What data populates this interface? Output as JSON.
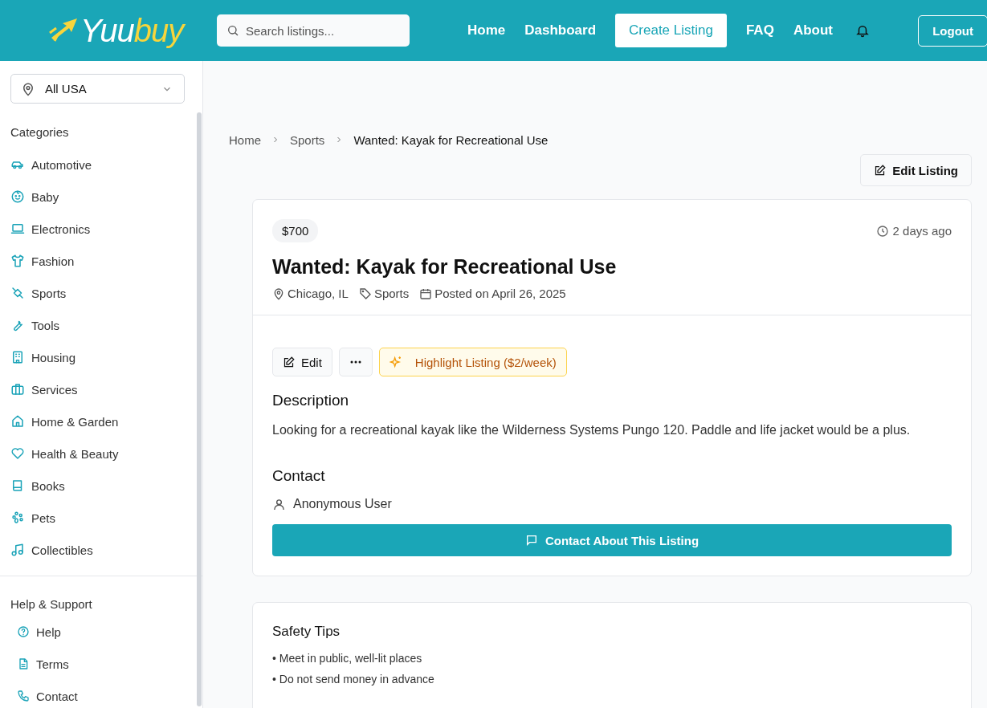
{
  "header": {
    "logo": {
      "part1": "Yuu",
      "part2": "buy"
    },
    "search": {
      "placeholder": "Search listings..."
    },
    "nav": [
      {
        "label": "Home",
        "kind": "link"
      },
      {
        "label": "Dashboard",
        "kind": "link"
      },
      {
        "label": "Create Listing",
        "kind": "primary"
      },
      {
        "label": "FAQ",
        "kind": "link"
      },
      {
        "label": "About",
        "kind": "link"
      }
    ],
    "logout": "Logout"
  },
  "sidebar": {
    "location": {
      "value": "All USA"
    },
    "categories_title": "Categories",
    "categories": [
      "Automotive",
      "Baby",
      "Electronics",
      "Fashion",
      "Sports",
      "Tools",
      "Housing",
      "Services",
      "Home & Garden",
      "Health & Beauty",
      "Books",
      "Pets",
      "Collectibles"
    ],
    "help_title": "Help & Support",
    "help": [
      "Help",
      "Terms",
      "Contact"
    ]
  },
  "breadcrumb": [
    "Home",
    "Sports",
    "Wanted: Kayak for Recreational Use"
  ],
  "edit_listing": "Edit Listing",
  "listing": {
    "price": "$700",
    "age": "2 days ago",
    "title": "Wanted: Kayak for Recreational Use",
    "location": "Chicago, IL",
    "category": "Sports",
    "posted": "Posted on April 26, 2025",
    "edit": "Edit",
    "highlight": "Highlight Listing ($2/week)",
    "description_title": "Description",
    "description": "Looking for a recreational kayak like the Wilderness Systems Pungo 120. Paddle and life jacket would be a plus.",
    "contact_title": "Contact",
    "contact_user": "Anonymous User",
    "contact_button": "Contact About This Listing"
  },
  "safety": {
    "title": "Safety Tips",
    "tips": [
      "• Meet in public, well-lit places",
      "• Do not send money in advance"
    ]
  }
}
